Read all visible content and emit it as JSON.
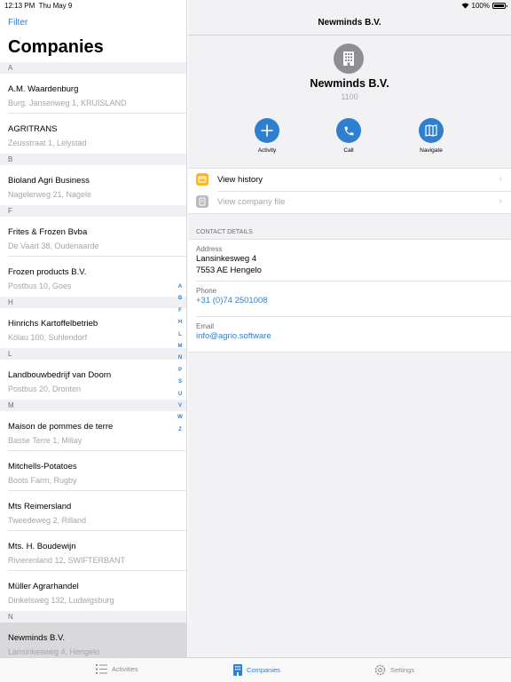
{
  "status_bar": {
    "time": "12:13 PM",
    "date": "Thu May 9",
    "battery": "100%"
  },
  "left": {
    "filter_label": "Filter",
    "title": "Companies",
    "sections": [
      {
        "letter": "A",
        "items": [
          {
            "name": "A.M. Waardenburg",
            "address": "Burg. Jansenweg 1, KRUISLAND"
          },
          {
            "name": "AGRITRANS",
            "address": "Zeusstraat 1, Lelystad"
          }
        ]
      },
      {
        "letter": "B",
        "items": [
          {
            "name": "Bioland Agri Business",
            "address": "Nagelerweg 21, Nagele"
          }
        ]
      },
      {
        "letter": "F",
        "items": [
          {
            "name": "Frites & Frozen Bvba",
            "address": "De Vaart 38, Oudenaarde"
          },
          {
            "name": "Frozen products B.V.",
            "address": "Postbus 10, Goes"
          }
        ]
      },
      {
        "letter": "H",
        "items": [
          {
            "name": "Hinrichs Kartoffelbetrieb",
            "address": "Kölau 100, Suhlendorf"
          }
        ]
      },
      {
        "letter": "L",
        "items": [
          {
            "name": "Landbouwbedrijf van Doorn",
            "address": "Postbus 20, Dronten"
          }
        ]
      },
      {
        "letter": "M",
        "items": [
          {
            "name": "Maison de pommes de terre",
            "address": "Basse Terre 1, Millay"
          },
          {
            "name": "Mitchells-Potatoes",
            "address": "Boots Farm, Rugby"
          },
          {
            "name": "Mts Reimersland",
            "address": "Tweedeweg 2, Rilland"
          },
          {
            "name": "Mts. H. Boudewijn",
            "address": "Rivierenland 12, SWIFTERBANT"
          },
          {
            "name": "Müller Agrarhandel",
            "address": "Dinkelsweg 132, Ludwigsburg"
          }
        ]
      },
      {
        "letter": "N",
        "items": [
          {
            "name": "Newminds B.V.",
            "address": "Lansinkesweg 4, Hengelo"
          }
        ]
      }
    ],
    "index_letters": [
      "A",
      "B",
      "F",
      "H",
      "L",
      "M",
      "N",
      "P",
      "S",
      "U",
      "V",
      "W",
      "Z"
    ]
  },
  "detail": {
    "nav_title": "Newminds B.V.",
    "company_name": "Newminds B.V.",
    "company_number": "1100",
    "actions": [
      {
        "label": "Activity",
        "icon": "plus-icon"
      },
      {
        "label": "Call",
        "icon": "phone-icon"
      },
      {
        "label": "Navigate",
        "icon": "map-icon"
      }
    ],
    "menu": [
      {
        "label": "View history",
        "icon": "folder-icon",
        "color": "#f7b924"
      },
      {
        "label": "View company file",
        "icon": "document-icon",
        "color": "#b9b9be"
      }
    ],
    "contact_header": "CONTACT DETAILS",
    "address_label": "Address",
    "address_line1": "Lansinkesweg 4",
    "address_line2": "7553 AE Hengelo",
    "phone_label": "Phone",
    "phone": "+31 (0)74 2501008",
    "email_label": "Email",
    "email": "info@agrio.software"
  },
  "tabbar": {
    "activities": "Activities",
    "companies": "Companies",
    "settings": "Settings"
  },
  "colors": {
    "accent": "#2f7fd1",
    "history_icon": "#f7b924",
    "file_icon": "#b9b9be"
  }
}
